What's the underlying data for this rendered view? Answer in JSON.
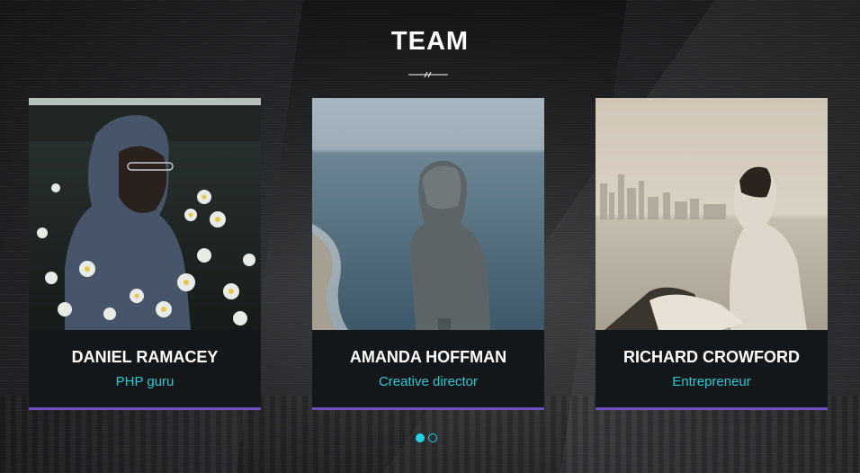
{
  "section": {
    "title": "TEAM"
  },
  "team": [
    {
      "name": "DANIEL RAMACEY",
      "role": "PHP guru",
      "photo": "person-hood-flowers"
    },
    {
      "name": "AMANDA HOFFMAN",
      "role": "Creative director",
      "photo": "person-hood-sea"
    },
    {
      "name": "RICHARD CROWFORD",
      "role": "Entrepreneur",
      "photo": "man-city-skyline"
    }
  ],
  "carousel": {
    "pages": 2,
    "active": 1
  },
  "colors": {
    "accent": "#29c9d6",
    "card_bar": "#6d4fc2",
    "card_bg": "#131719"
  }
}
